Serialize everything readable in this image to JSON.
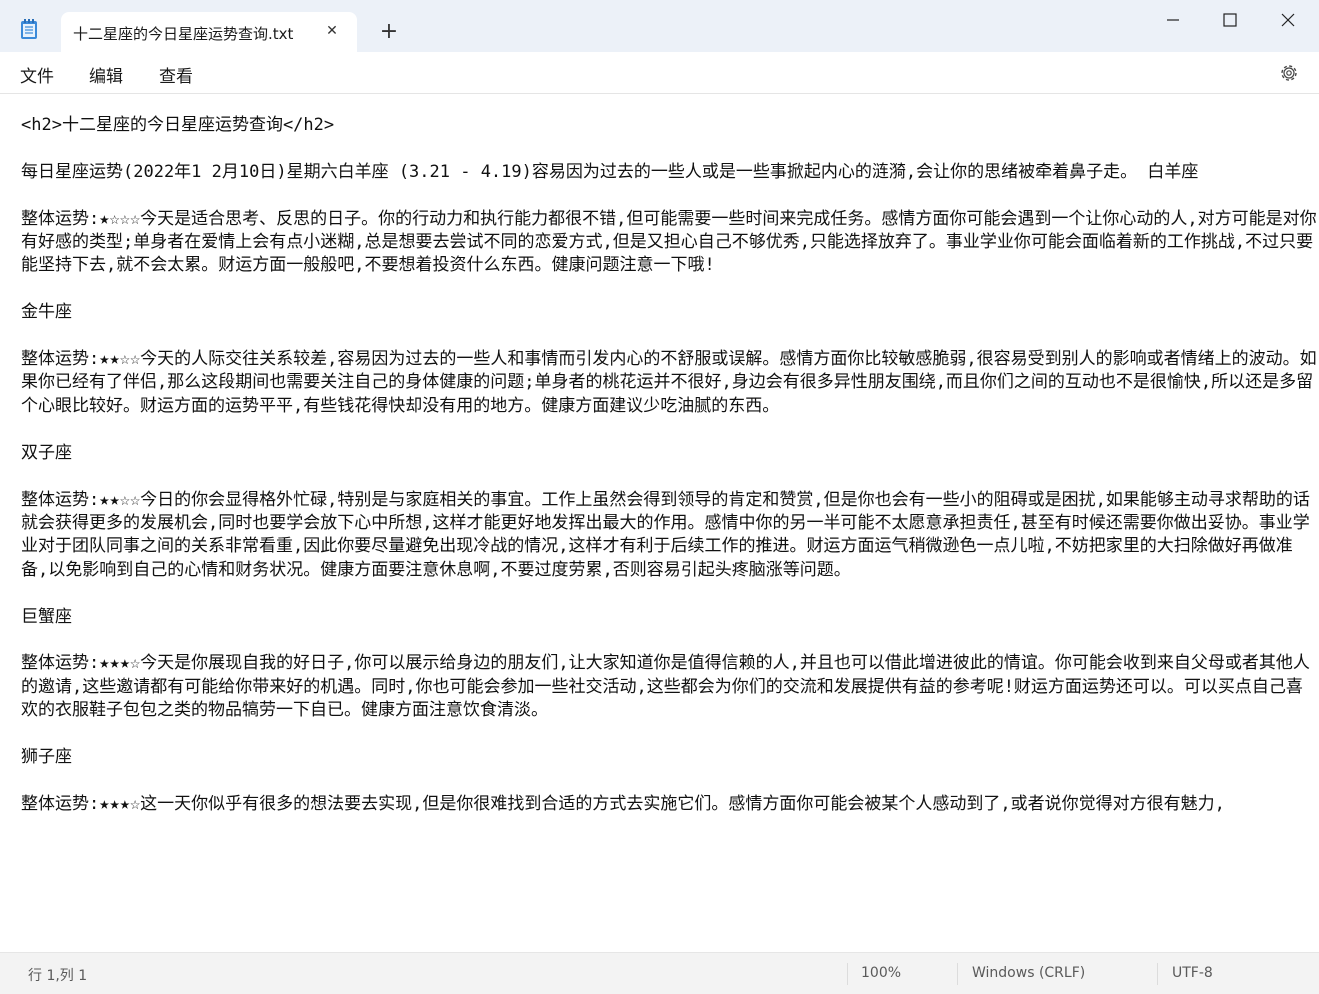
{
  "window": {
    "tab_title": "十二星座的今日星座运势查询.txt",
    "new_tab": "+",
    "tab_close": "✕"
  },
  "menu": {
    "file": "文件",
    "edit": "编辑",
    "view": "查看"
  },
  "document": {
    "content": "<h2>十二星座的今日星座运势查询</h2>\n\n每日星座运势(2022年1 2月10日)星期六白羊座 (3.21 - 4.19)容易因为过去的一些人或是一些事掀起内心的涟漪,会让你的思绪被牵着鼻子走。 白羊座\n\n整体运势:★☆☆☆今天是适合思考、反思的日子。你的行动力和执行能力都很不错,但可能需要一些时间来完成任务。感情方面你可能会遇到一个让你心动的人,对方可能是对你有好感的类型;单身者在爱情上会有点小迷糊,总是想要去尝试不同的恋爱方式,但是又担心自己不够优秀,只能选择放弃了。事业学业你可能会面临着新的工作挑战,不过只要能坚持下去,就不会太累。财运方面一般般吧,不要想着投资什么东西。健康问题注意一下哦!\n\n金牛座\n\n整体运势:★★☆☆今天的人际交往关系较差,容易因为过去的一些人和事情而引发内心的不舒服或误解。感情方面你比较敏感脆弱,很容易受到别人的影响或者情绪上的波动。如果你已经有了伴侣,那么这段期间也需要关注自己的身体健康的问题;单身者的桃花运并不很好,身边会有很多异性朋友围绕,而且你们之间的互动也不是很愉快,所以还是多留个心眼比较好。财运方面的运势平平,有些钱花得快却没有用的地方。健康方面建议少吃油腻的东西。\n\n双子座\n\n整体运势:★★☆☆今日的你会显得格外忙碌,特别是与家庭相关的事宜。工作上虽然会得到领导的肯定和赞赏,但是你也会有一些小的阻碍或是困扰,如果能够主动寻求帮助的话就会获得更多的发展机会,同时也要学会放下心中所想,这样才能更好地发挥出最大的作用。感情中你的另一半可能不太愿意承担责任,甚至有时候还需要你做出妥协。事业学业对于团队同事之间的关系非常看重,因此你要尽量避免出现冷战的情况,这样才有利于后续工作的推进。财运方面运气稍微逊色一点儿啦,不妨把家里的大扫除做好再做准备,以免影响到自己的心情和财务状况。健康方面要注意休息啊,不要过度劳累,否则容易引起头疼脑涨等问题。\n\n巨蟹座\n\n整体运势:★★★☆今天是你展现自我的好日子,你可以展示给身边的朋友们,让大家知道你是值得信赖的人,并且也可以借此增进彼此的情谊。你可能会收到来自父母或者其他人的邀请,这些邀请都有可能给你带来好的机遇。同时,你也可能会参加一些社交活动,这些都会为你们的交流和发展提供有益的参考呢!财运方面运势还可以。可以买点自己喜欢的衣服鞋子包包之类的物品犒劳一下自已。健康方面注意饮食清淡。\n\n狮子座\n\n整体运势:★★★☆这一天你似乎有很多的想法要去实现,但是你很难找到合适的方式去实施它们。感情方面你可能会被某个人感动到了,或者说你觉得对方很有魅力,"
  },
  "status": {
    "position": "行 1,列 1",
    "zoom": "100%",
    "line_ending": "Windows (CRLF)",
    "encoding": "UTF-8"
  }
}
